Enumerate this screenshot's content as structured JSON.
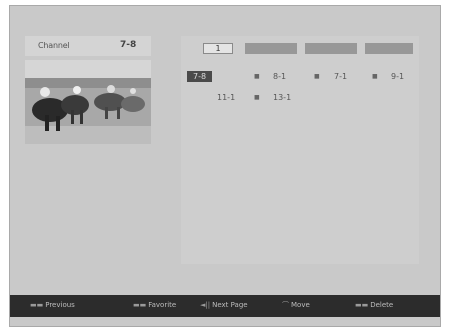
{
  "channel": {
    "label": "Channel",
    "number": "7-8"
  },
  "tabs": [
    {
      "label": "1",
      "active": true
    },
    {
      "label": "",
      "active": false
    },
    {
      "label": "",
      "active": false
    },
    {
      "label": "",
      "active": false
    }
  ],
  "entries": {
    "row1": [
      "7-8",
      "8-1",
      "7-1",
      "9-1"
    ],
    "row2": [
      "11-1",
      "13-1"
    ]
  },
  "bottom": {
    "items": [
      {
        "key": "▬▬",
        "label": "Previous"
      },
      {
        "key": "▬▬",
        "label": "Favorite"
      },
      {
        "key": "◄||",
        "label": "Next Page"
      },
      {
        "key": "⌒",
        "label": "Move"
      },
      {
        "key": "▬▬",
        "label": "Delete"
      }
    ]
  }
}
